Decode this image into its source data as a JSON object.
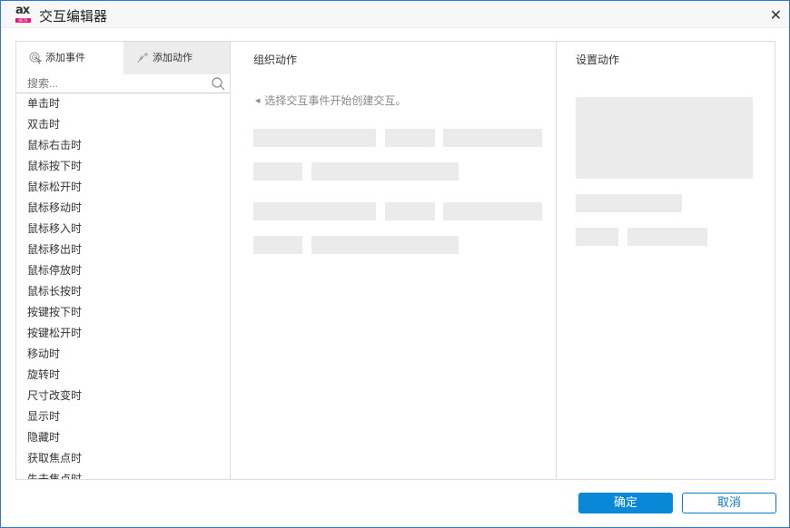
{
  "window": {
    "title": "交互编辑器",
    "logo_text": "ax",
    "logo_badge": "BETA"
  },
  "left_panel": {
    "tabs": [
      {
        "label": "添加事件",
        "icon": "cursor-click-icon"
      },
      {
        "label": "添加动作",
        "icon": "sparkle-icon"
      }
    ],
    "search": {
      "placeholder": "搜索..."
    },
    "events": [
      "单击时",
      "双击时",
      "鼠标右击时",
      "鼠标按下时",
      "鼠标松开时",
      "鼠标移动时",
      "鼠标移入时",
      "鼠标移出时",
      "鼠标停放时",
      "鼠标长按时",
      "按键按下时",
      "按键松开时",
      "移动时",
      "旋转时",
      "尺寸改变时",
      "显示时",
      "隐藏时",
      "获取焦点时",
      "失去焦点时"
    ]
  },
  "middle_panel": {
    "title": "组织动作",
    "hint": "选择交互事件开始创建交互。"
  },
  "right_panel": {
    "title": "设置动作"
  },
  "footer": {
    "ok_label": "确定",
    "cancel_label": "取消"
  },
  "colors": {
    "accent": "#0a88d8",
    "border": "#2b79d0",
    "placeholder": "#ebebeb"
  }
}
